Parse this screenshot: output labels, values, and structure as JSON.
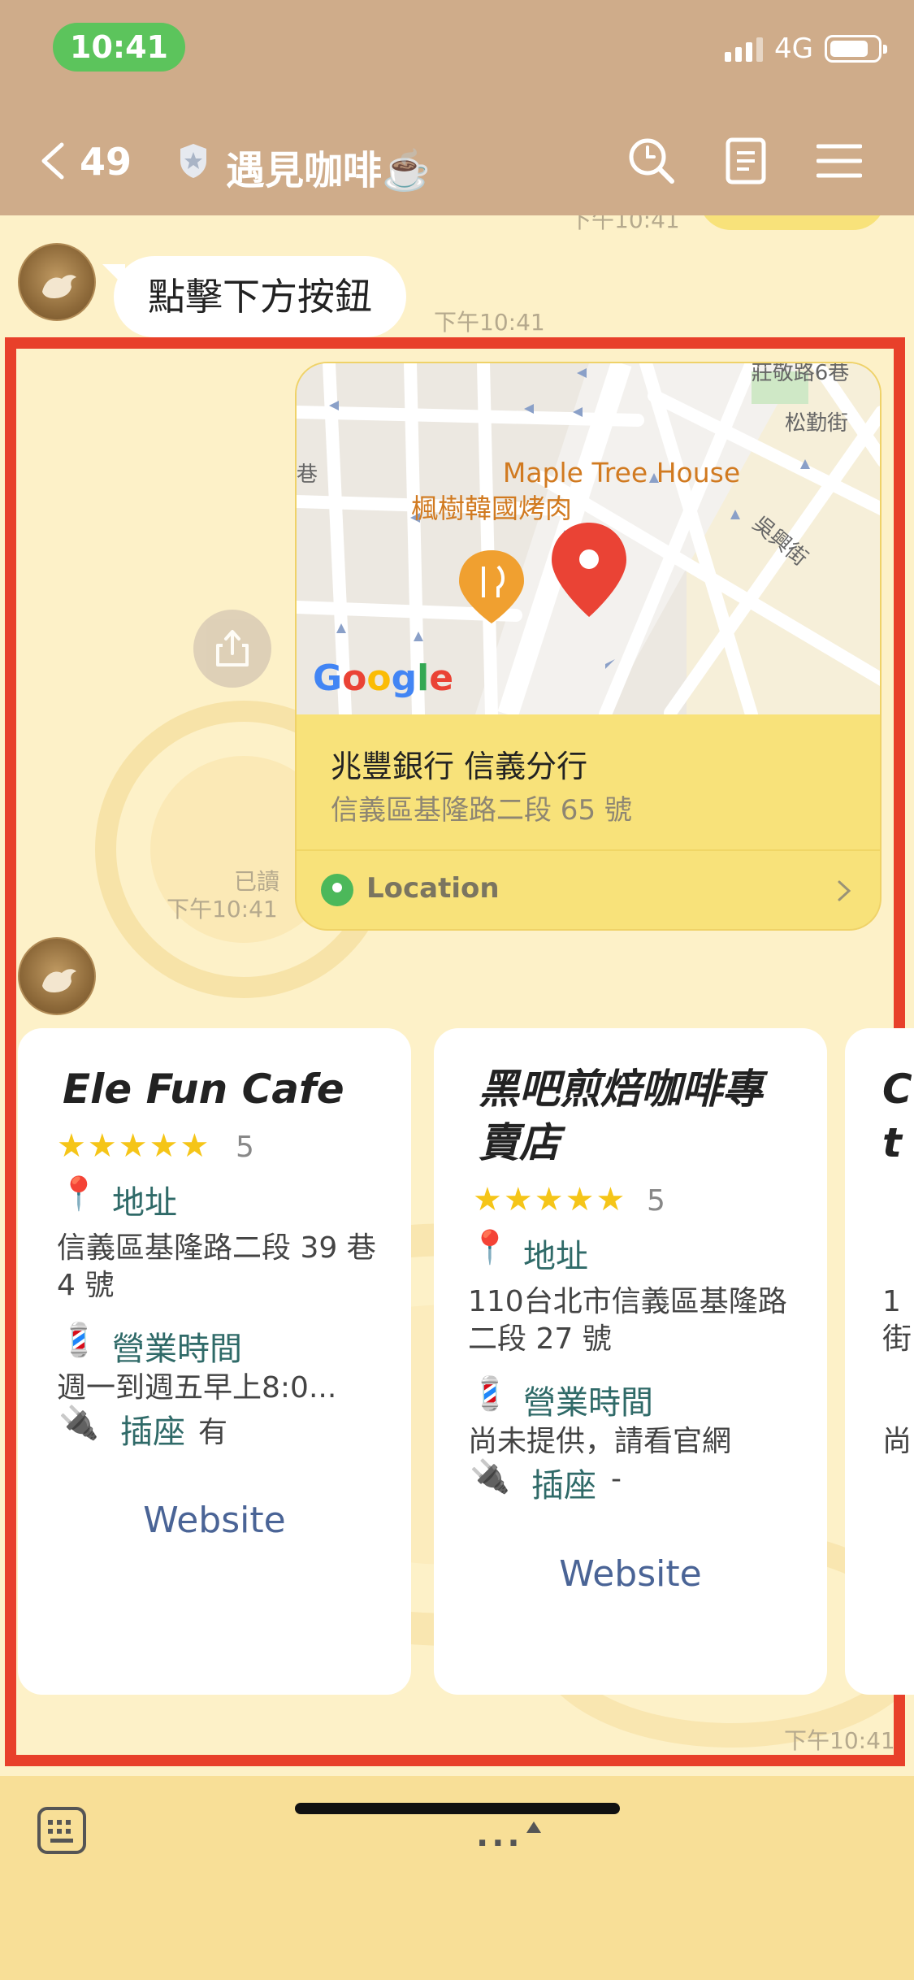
{
  "status_bar": {
    "time": "10:41",
    "network": "4G"
  },
  "nav": {
    "back_count": "49",
    "title": "遇見咖啡☕️",
    "icons": [
      "back-icon",
      "shield-icon",
      "search-icon",
      "notes-icon",
      "menu-icon"
    ]
  },
  "messages": {
    "peek_time": "下午10:41",
    "prompt": {
      "text": "點擊下方按鈕",
      "time": "下午10:41"
    },
    "location": {
      "map_labels": {
        "restaurant_en": "Maple Tree House",
        "restaurant_zh": "楓樹韓國烤肉",
        "street_1": "莊敬路6巷",
        "street_2": "松勤街",
        "street_3": "吳興街",
        "lane": "巷",
        "map_brand": "Google"
      },
      "name": "兆豐銀行 信義分行",
      "address": "信義區基隆路二段 65 號",
      "action_label": "Location",
      "read": "已讀",
      "time": "下午10:41"
    },
    "carousel": {
      "time": "下午10:41",
      "cards": [
        {
          "name": "Ele Fun Cafe",
          "stars": "★★★★★",
          "rating": "5",
          "address_label": "地址",
          "address": "信義區基隆路二段 39 巷 4 號",
          "hours_label": "營業時間",
          "hours": "週一到週五早上8:0...",
          "outlet_label": "插座",
          "outlet": "有",
          "website": "Website"
        },
        {
          "name": "黑吧煎焙咖啡專賣店",
          "stars": "★★★★★",
          "rating": "5",
          "address_label": "地址",
          "address": "110台北市信義區基隆路二段 27 號",
          "hours_label": "營業時間",
          "hours": "尚未提供，請看官網",
          "outlet_label": "插座",
          "outlet": "-",
          "website": "Website"
        },
        {
          "name": "C",
          "name_line2": "t",
          "address_peek": "1",
          "address_peek2": "街",
          "hours_peek": "尚"
        }
      ]
    }
  },
  "colors": {
    "header": "#cfac8a",
    "chat_bg": "#fdf1c8",
    "highlight": "#e8402a",
    "location_card": "#f8e27a",
    "link": "#4a6496",
    "label": "#2f6a68"
  },
  "emoji": {
    "pin": "📍",
    "barber": "💈",
    "plug": "🔌"
  }
}
